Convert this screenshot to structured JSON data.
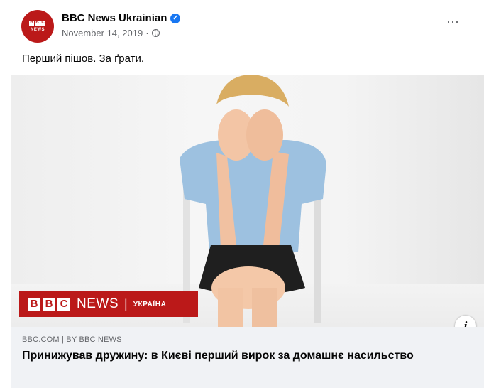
{
  "post": {
    "page_name": "BBC News Ukrainian",
    "avatar": {
      "blocks": [
        "B",
        "B",
        "C"
      ],
      "text": "NEWS"
    },
    "date": "November 14, 2019",
    "date_separator": "·",
    "more_icon": "⋯",
    "caption": "Перший пішов. За ґрати."
  },
  "link_preview": {
    "banner": {
      "blocks": [
        "B",
        "B",
        "C"
      ],
      "news": "NEWS",
      "separator": "|",
      "region": "УКРАЇНА"
    },
    "info_icon": "i",
    "domain": "BBC.COM | BY BBC NEWS",
    "headline": "Принижував дружину: в Києві перший вирок за домашнє насильство"
  },
  "colors": {
    "bbc_red": "#bb1919",
    "verified_blue": "#1877f2",
    "link_box_bg": "#f0f2f5",
    "secondary_text": "#65676b"
  }
}
